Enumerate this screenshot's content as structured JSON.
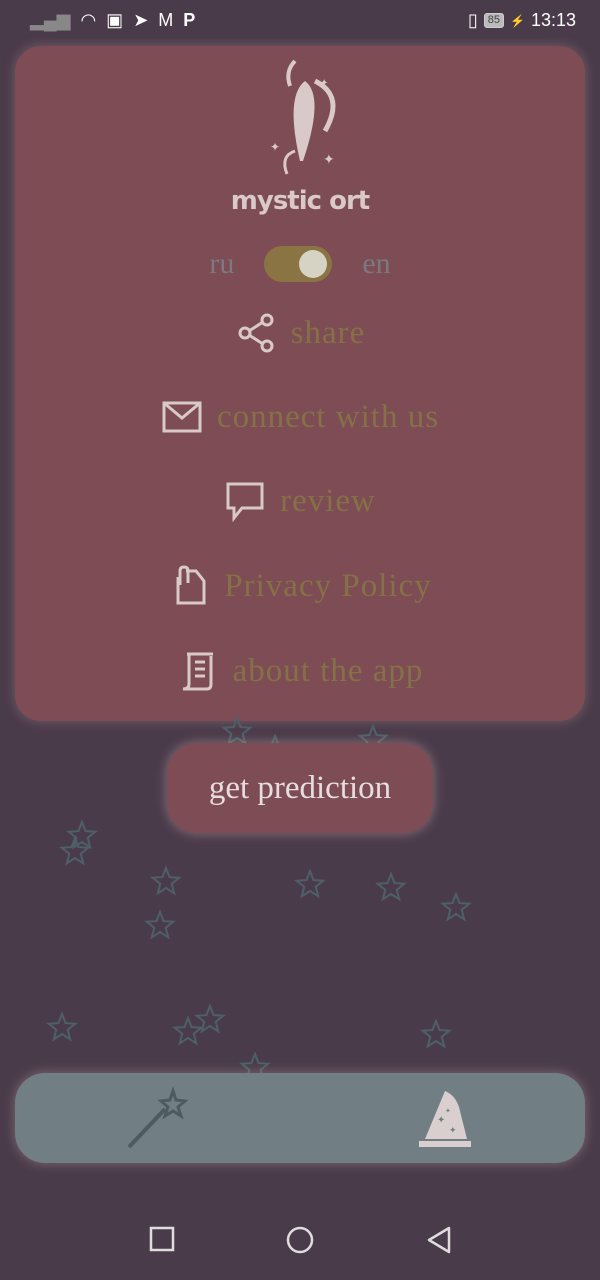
{
  "status_bar": {
    "time": "13:13",
    "battery": "85"
  },
  "logo": {
    "text": "mystic ort"
  },
  "language": {
    "left": "ru",
    "right": "en",
    "selected": "en"
  },
  "menu": [
    {
      "icon": "share-icon",
      "label": "share"
    },
    {
      "icon": "mail-icon",
      "label": "connect with us"
    },
    {
      "icon": "chat-icon",
      "label": "review"
    },
    {
      "icon": "document-icon",
      "label": "Privacy Policy"
    },
    {
      "icon": "scroll-icon",
      "label": "about the app"
    }
  ],
  "predict_button": "get prediction",
  "colors": {
    "background": "#4a3b4a",
    "card": "#7d4c54",
    "menu_text": "#857146",
    "nav": "#717f85"
  }
}
